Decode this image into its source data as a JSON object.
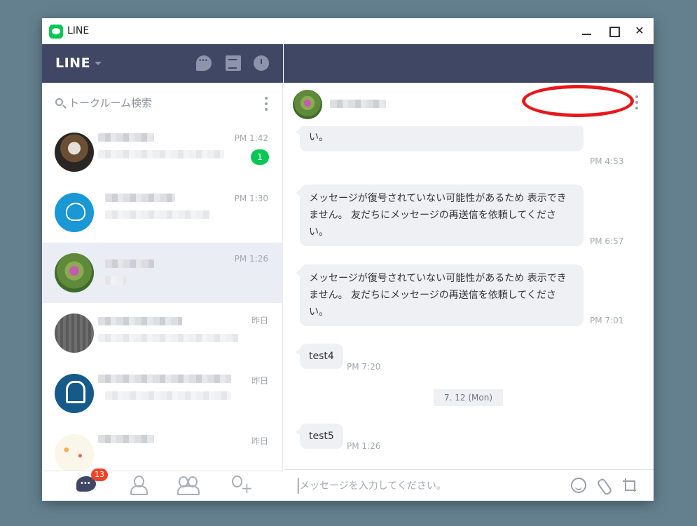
{
  "window": {
    "title": "LINE"
  },
  "sidebar": {
    "brand": "LINE",
    "search_placeholder": "トークルーム検索",
    "chats": [
      {
        "time": "PM 1:42",
        "unread": "1"
      },
      {
        "time": "PM 1:30"
      },
      {
        "time": "PM 1:26"
      },
      {
        "time": "昨日"
      },
      {
        "time": "昨日"
      },
      {
        "time": "昨日"
      }
    ],
    "footer": {
      "chat_badge": "13"
    }
  },
  "conversation": {
    "messages": [
      {
        "text": "い。",
        "time": "PM 4:53"
      },
      {
        "text": "メッセージが復号されていない可能性があるため 表示できません。 友だちにメッセージの再送信を依頼してください。",
        "time": "PM 6:57"
      },
      {
        "text": "メッセージが復号されていない可能性があるため 表示できません。 友だちにメッセージの再送信を依頼してください。",
        "time": "PM 7:01"
      },
      {
        "text": "test4",
        "time": "PM 7:20"
      },
      {
        "text": "test5",
        "time": "PM 1:26"
      }
    ],
    "date_separator": "7. 12 (Mon)",
    "input_placeholder": "メッセージを入力してください。"
  },
  "colors": {
    "header": "#3f4764",
    "line_green": "#06c755",
    "badge_red": "#ef4428",
    "annotation_red": "#e8171a"
  }
}
